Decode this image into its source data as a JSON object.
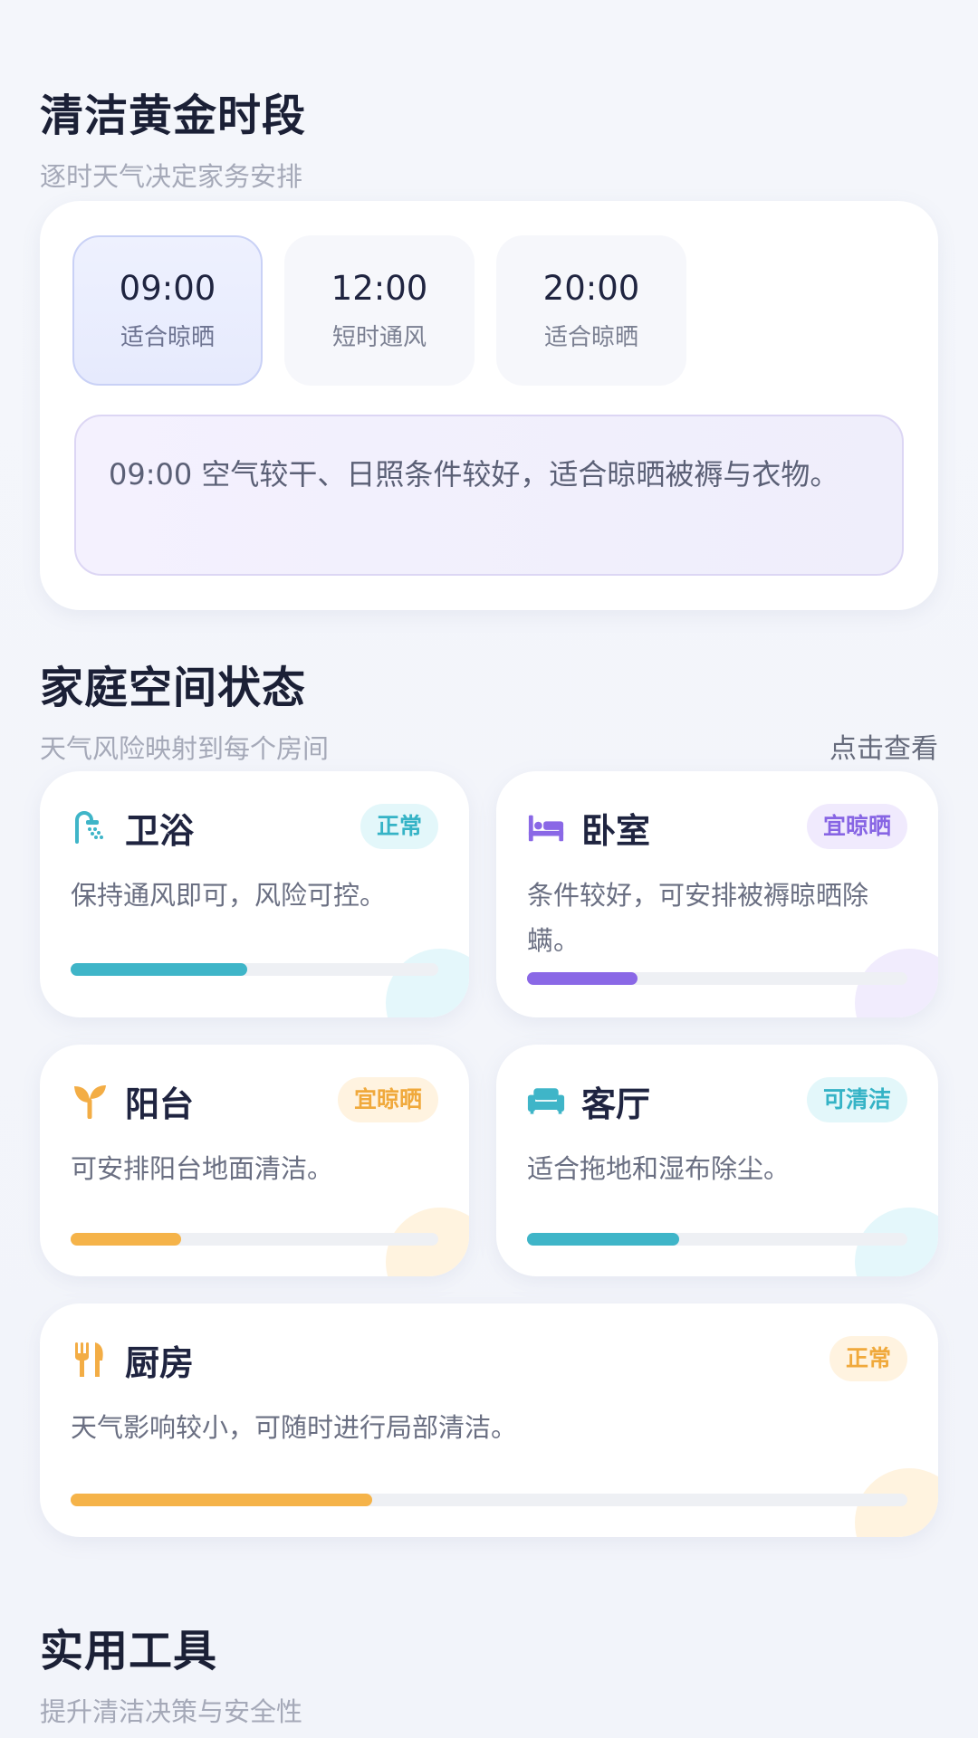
{
  "golden": {
    "title": "清洁黄金时段",
    "subtitle": "逐时天气决定家务安排",
    "slots": [
      {
        "time": "09:00",
        "label": "适合晾晒"
      },
      {
        "time": "12:00",
        "label": "短时通风"
      },
      {
        "time": "20:00",
        "label": "适合晾晒"
      }
    ],
    "note": "09:00 空气较干、日照条件较好，适合晾晒被褥与衣物。"
  },
  "spaces": {
    "title": "家庭空间状态",
    "subtitle": "天气风险映射到每个房间",
    "link": "点击查看",
    "rooms": [
      {
        "name": "卫浴",
        "icon": "shower-icon",
        "badge": "正常",
        "desc": "保持通风即可，风险可控。",
        "progress": 0.48,
        "color": "#3fb5c8",
        "badge_bg": "#e3f7fa",
        "badge_fg": "#35b3c6"
      },
      {
        "name": "卧室",
        "icon": "bed-icon",
        "badge": "宜晾晒",
        "desc": "条件较好，可安排被褥晾晒除螨。",
        "progress": 0.29,
        "color": "#8a68e6",
        "badge_bg": "#f0eafd",
        "badge_fg": "#8765e4"
      },
      {
        "name": "阳台",
        "icon": "sprout-icon",
        "badge": "宜晾晒",
        "desc": "可安排阳台地面清洁。",
        "progress": 0.3,
        "color": "#f5b349",
        "badge_bg": "#fff3e0",
        "badge_fg": "#f0a93c"
      },
      {
        "name": "客厅",
        "icon": "sofa-icon",
        "badge": "可清洁",
        "desc": "适合拖地和湿布除尘。",
        "progress": 0.4,
        "color": "#3fb5c8",
        "badge_bg": "#e3f7fa",
        "badge_fg": "#35b3c6"
      },
      {
        "name": "厨房",
        "icon": "utensils-icon",
        "badge": "正常",
        "desc": "天气影响较小，可随时进行局部清洁。",
        "progress": 0.36,
        "color": "#f5b349",
        "badge_bg": "#fff3e0",
        "badge_fg": "#f0a93c"
      }
    ]
  },
  "tools": {
    "title": "实用工具",
    "subtitle": "提升清洁决策与安全性"
  }
}
